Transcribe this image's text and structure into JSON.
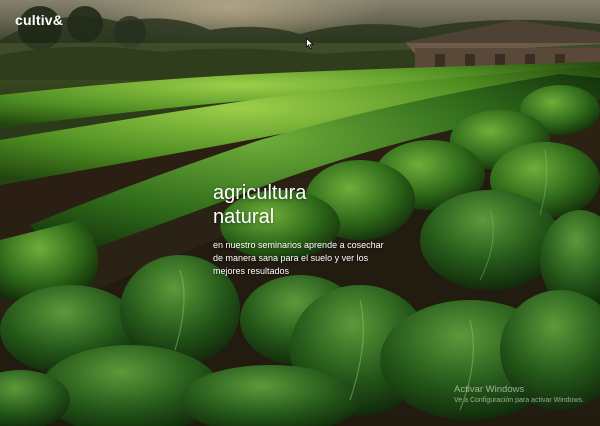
{
  "header": {
    "logo": "cultiv&"
  },
  "hero": {
    "title_line1": "agricultura",
    "title_line2": "natural",
    "description": "en nuestro seminarios aprende a cosechar de manera sana para el suelo y ver los mejores resultados",
    "background_image": "vegetable-field-photo"
  },
  "system_watermark": {
    "title": "Activar Windows",
    "subtitle": "Ve a Configuración para activar Windows."
  },
  "colors": {
    "accent_text": "#ffffff",
    "leaf_green": "#3f7a1e",
    "soil": "#2a1e12"
  },
  "icons": {
    "cursor": "mouse-pointer-icon"
  }
}
